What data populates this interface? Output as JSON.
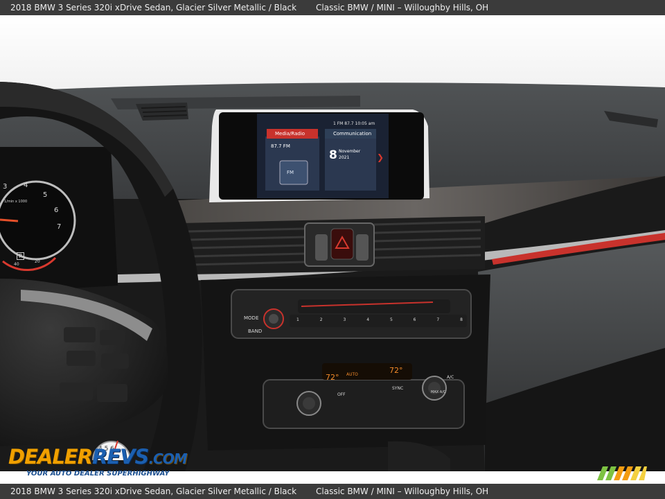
{
  "header": {
    "description": "2018 BMW 3 Series 320i xDrive Sedan,   Glacier Silver Metallic  /  Black",
    "dealer": "Classic BMW / MINI  –  Willoughby Hills, OH"
  },
  "footer": {
    "description": "2018 BMW 3 Series 320i xDrive Sedan,   Glacier Silver Metallic  /  Black",
    "dealer": "Classic BMW / MINI  –  Willoughby Hills, OH"
  },
  "watermark": {
    "brand_a": "DEALER",
    "brand_b": "REVS",
    "brand_c": ".COM",
    "tagline": "YOUR AUTO DEALER SUPERHIGHWAY",
    "gauge": "4 5 6"
  },
  "infotainment": {
    "status": "1   FM 87.7   10:05  am",
    "media_tab": "Media/Radio",
    "comm_tab": "Communication",
    "station": "87.7 FM",
    "day": "8",
    "month": "November",
    "year": "2021",
    "source_button": "FM"
  },
  "controls": {
    "mode": "MODE",
    "band": "BAND",
    "presets": [
      "1",
      "2",
      "3",
      "4",
      "5",
      "6",
      "7",
      "8"
    ],
    "temp_left": "72°",
    "temp_right": "72°",
    "auto": "AUTO",
    "off": "OFF",
    "sync": "SYNC",
    "ac": "A/C",
    "max_ac": "MAX A/C"
  },
  "cluster": {
    "ticks": [
      "3",
      "4",
      "5",
      "6",
      "7"
    ],
    "unit": "1/min x 1000",
    "gear": "P",
    "temp_low": "40",
    "temp_high": "20"
  },
  "colors": {
    "accent_red": "#d8392e",
    "bar": "#3b3b3b",
    "watermark_orange": "#f0a000",
    "watermark_blue": "#1b5fb0"
  }
}
